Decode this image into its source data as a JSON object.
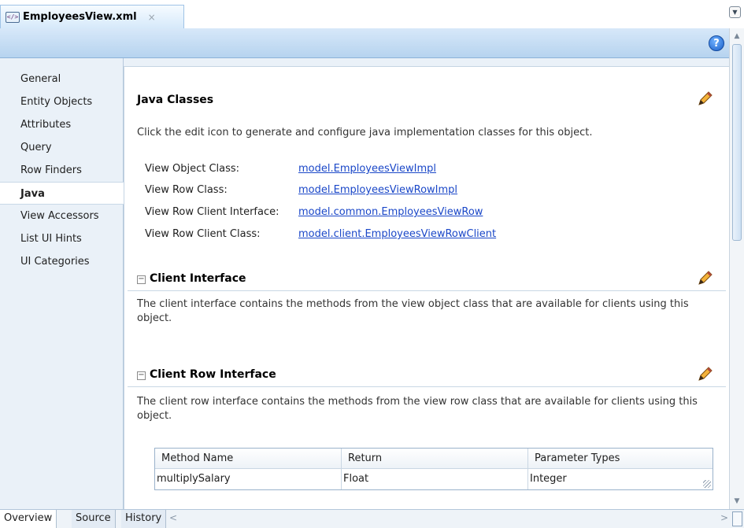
{
  "editor_tab": {
    "title": "EmployeesView.xml",
    "close": "×",
    "icon": "xml-file-icon"
  },
  "help_label": "?",
  "nav": {
    "items": [
      {
        "label": "General",
        "active": false
      },
      {
        "label": "Entity Objects",
        "active": false
      },
      {
        "label": "Attributes",
        "active": false
      },
      {
        "label": "Query",
        "active": false
      },
      {
        "label": "Row Finders",
        "active": false
      },
      {
        "label": "Java",
        "active": true
      },
      {
        "label": "View Accessors",
        "active": false
      },
      {
        "label": "List UI Hints",
        "active": false
      },
      {
        "label": "UI Categories",
        "active": false
      }
    ]
  },
  "java_classes": {
    "title": "Java Classes",
    "description": "Click the edit icon to generate and configure java implementation classes for this object.",
    "rows": [
      {
        "label": "View Object Class:",
        "value": "model.EmployeesViewImpl"
      },
      {
        "label": "View Row Class:",
        "value": "model.EmployeesViewRowImpl"
      },
      {
        "label": "View Row Client Interface:",
        "value": "model.common.EmployeesViewRow"
      },
      {
        "label": "View Row Client Class:",
        "value": "model.client.EmployeesViewRowClient"
      }
    ]
  },
  "client_interface": {
    "title": "Client Interface",
    "description": "The client interface contains the methods from the view object class that are available for clients using this object."
  },
  "client_row_interface": {
    "title": "Client Row Interface",
    "description": "The client row interface contains the methods from the view row class that are available for clients using this object.",
    "table": {
      "headers": [
        "Method Name",
        "Return",
        "Parameter Types"
      ],
      "rows": [
        [
          "multiplySalary",
          "Float",
          "Integer"
        ]
      ]
    }
  },
  "bottom_tabs": [
    {
      "label": "Overview",
      "active": true
    },
    {
      "label": "Source",
      "active": false
    },
    {
      "label": "History",
      "active": false
    }
  ],
  "colors": {
    "link": "#1a47c8",
    "header_blue": "#b6d3ef",
    "nav_bg": "#eaf1f8"
  }
}
